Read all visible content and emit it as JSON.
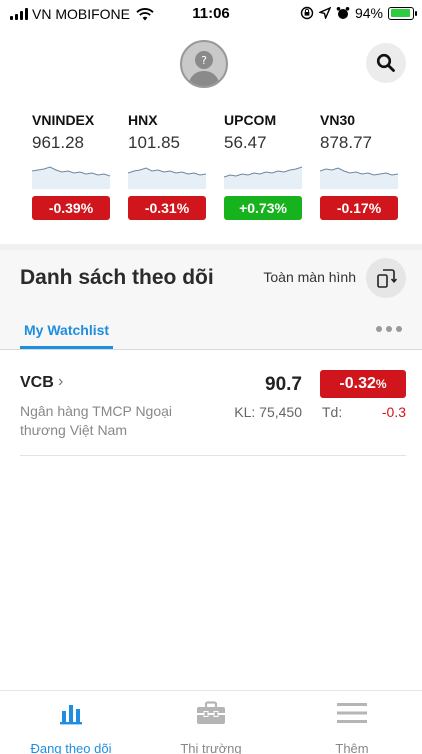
{
  "status_bar": {
    "carrier": "VN MOBIFONE",
    "time": "11:06",
    "battery": "94%"
  },
  "indices": [
    {
      "name": "VNINDEX",
      "value": "961.28",
      "change": "-0.39%",
      "direction": "down"
    },
    {
      "name": "HNX",
      "value": "101.85",
      "change": "-0.31%",
      "direction": "down"
    },
    {
      "name": "UPCOM",
      "value": "56.47",
      "change": "+0.73%",
      "direction": "up"
    },
    {
      "name": "VN30",
      "value": "878.77",
      "change": "-0.17%",
      "direction": "down"
    }
  ],
  "watchlist": {
    "title": "Danh sách theo dõi",
    "fullscreen_label": "Toàn màn hình",
    "active_tab": "My Watchlist"
  },
  "stocks": [
    {
      "symbol": "VCB",
      "name": "Ngân hàng TMCP Ngoại thương Việt Nam",
      "price": "90.7",
      "change_pct": "-0.32",
      "pct_sign": "%",
      "volume": "KL: 75,450",
      "td_label": "Td:",
      "td_value": "-0.3"
    }
  ],
  "bottom_nav": [
    {
      "label": "Đang theo dõi",
      "icon": "chart-bars-icon",
      "active": true
    },
    {
      "label": "Thị trường",
      "icon": "briefcase-icon",
      "active": false
    },
    {
      "label": "Thêm",
      "icon": "hamburger-menu-icon",
      "active": false
    }
  ],
  "colors": {
    "accent": "#1f8ee0",
    "down": "#d0161c",
    "up": "#17b31e"
  }
}
